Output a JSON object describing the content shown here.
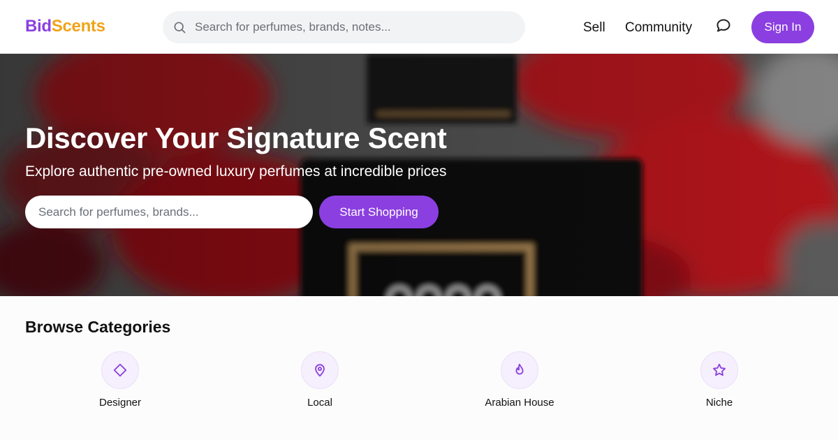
{
  "header": {
    "logo_part1": "Bid",
    "logo_part2": "Scents",
    "search_placeholder": "Search for perfumes, brands, notes...",
    "nav_sell": "Sell",
    "nav_community": "Community",
    "signin_label": "Sign In",
    "icons": {
      "search": "search-icon",
      "chat": "chat-bubble-icon"
    }
  },
  "hero": {
    "title": "Discover Your Signature Scent",
    "subtitle": "Explore authentic pre-owned luxury perfumes at incredible prices",
    "search_placeholder": "Search for perfumes, brands...",
    "cta_label": "Start Shopping"
  },
  "categories": {
    "title": "Browse Categories",
    "items": [
      {
        "label": "Designer",
        "icon": "diamond-icon"
      },
      {
        "label": "Local",
        "icon": "map-pin-icon"
      },
      {
        "label": "Arabian House",
        "icon": "flame-icon"
      },
      {
        "label": "Niche",
        "icon": "star-icon"
      }
    ]
  },
  "colors": {
    "brand_purple": "#8b3fe0",
    "brand_orange": "#f0a319",
    "category_bg": "#f6effd"
  }
}
